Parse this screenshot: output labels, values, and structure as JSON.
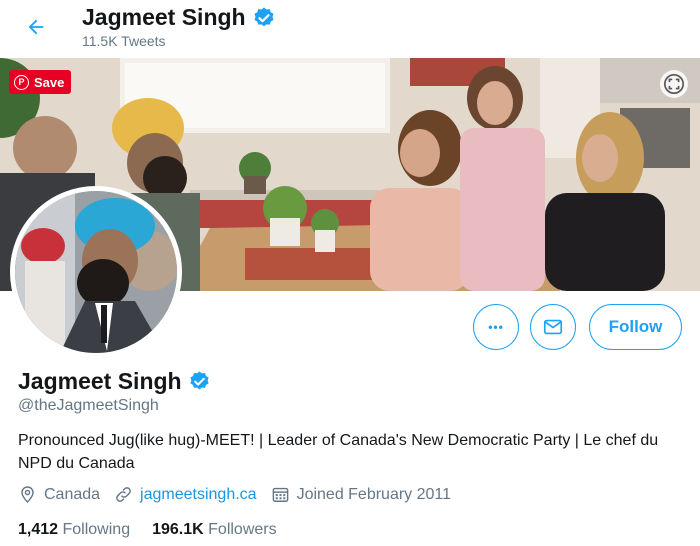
{
  "header": {
    "name": "Jagmeet Singh",
    "tweet_count": "11.5K Tweets"
  },
  "banner": {
    "save_label": "Save",
    "pin_glyph": "P"
  },
  "actions": {
    "more_glyph": "•••",
    "follow_label": "Follow"
  },
  "profile": {
    "name": "Jagmeet Singh",
    "handle": "@theJagmeetSingh",
    "bio": "Pronounced Jug(like hug)-MEET! | Leader of Canada's New Democratic Party | Le chef du NPD du Canada",
    "location": "Canada",
    "website": "jagmeetsingh.ca",
    "joined": "Joined February 2011"
  },
  "stats": {
    "following_count": "1,412",
    "following_label": "Following",
    "followers_count": "196.1K",
    "followers_label": "Followers"
  },
  "colors": {
    "accent": "#1da1f2",
    "link": "#1b95e0",
    "muted": "#657786",
    "pinterest": "#e60023"
  },
  "icons": [
    "back-arrow-icon",
    "verified-badge-icon",
    "pinterest-icon",
    "expand-icon",
    "more-icon",
    "envelope-icon",
    "location-pin-icon",
    "link-icon",
    "calendar-icon"
  ]
}
